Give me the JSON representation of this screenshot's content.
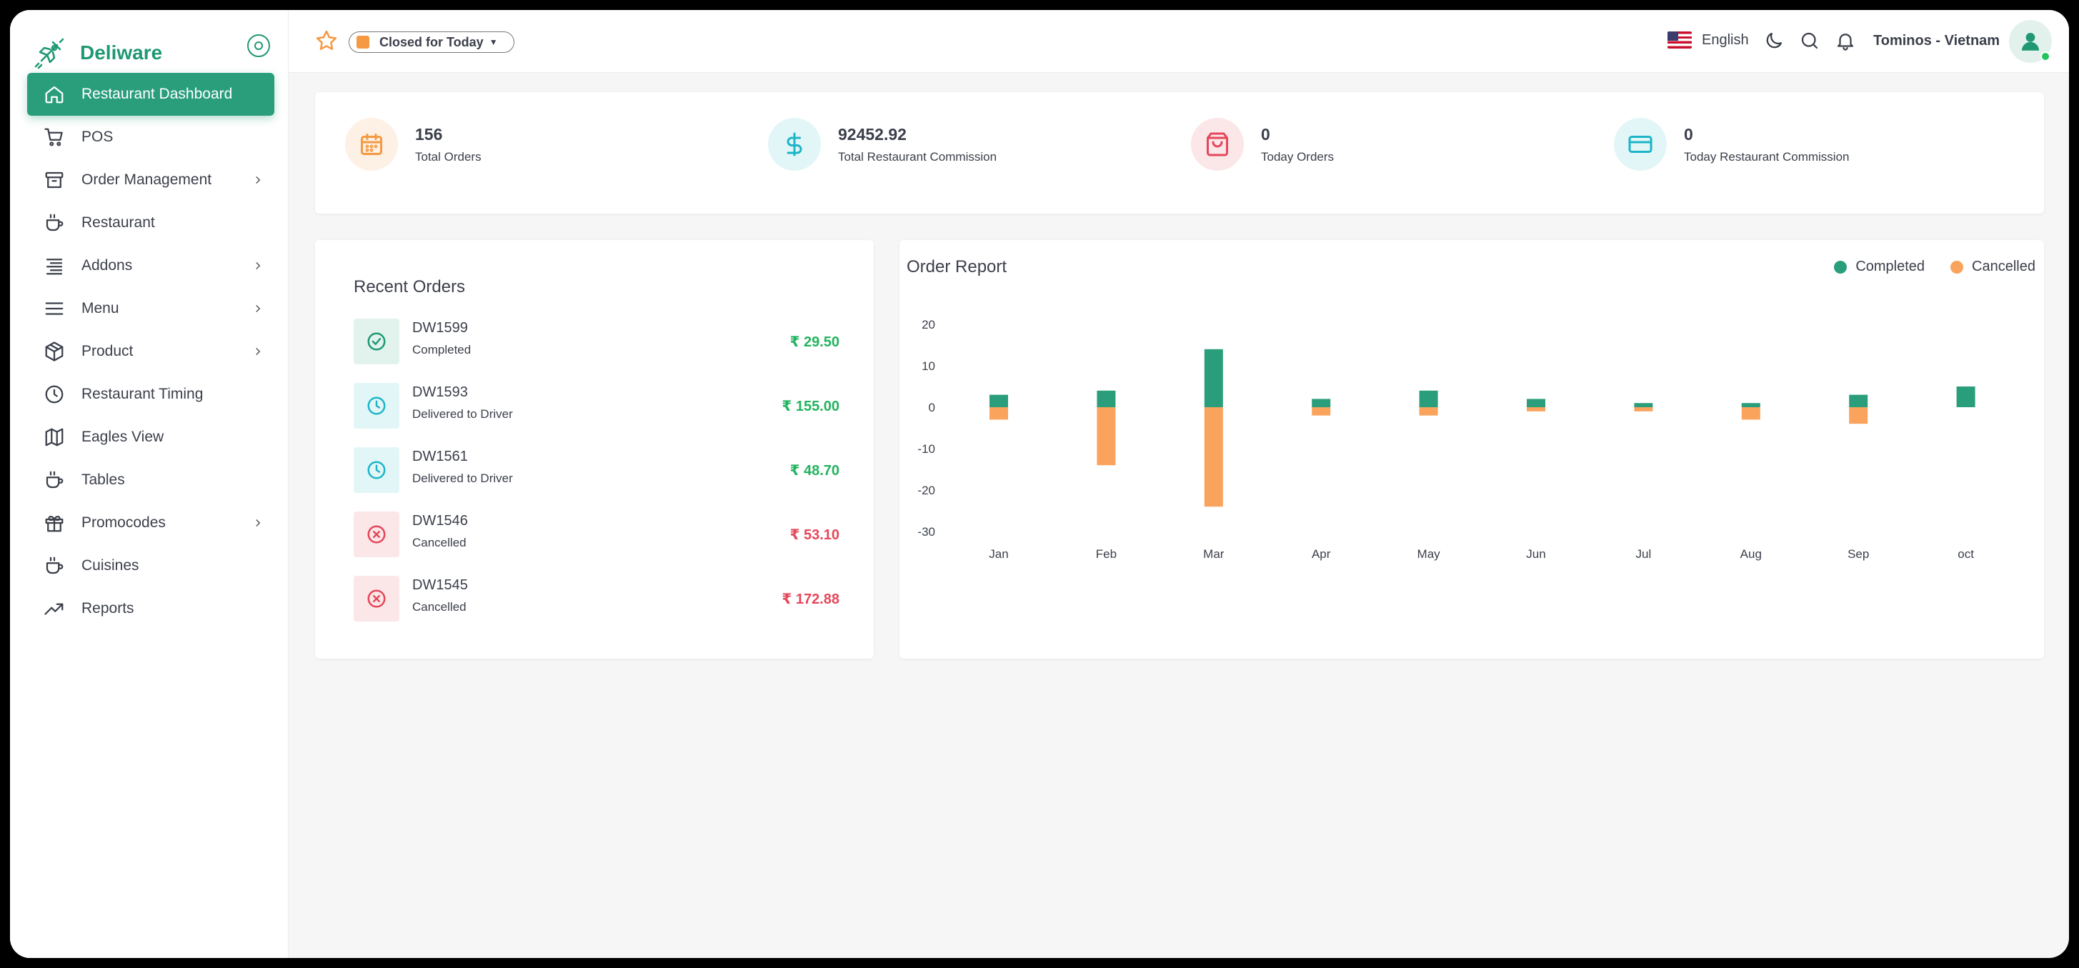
{
  "brand": {
    "name": "Deliware",
    "color": "#1f9873"
  },
  "sidebar": {
    "items": [
      {
        "label": "Restaurant Dashboard",
        "icon": "home-icon",
        "active": true,
        "chevron": false
      },
      {
        "label": "POS",
        "icon": "cart-icon",
        "active": false,
        "chevron": false
      },
      {
        "label": "Order Management",
        "icon": "archive-icon",
        "active": false,
        "chevron": true
      },
      {
        "label": "Restaurant",
        "icon": "cup-icon",
        "active": false,
        "chevron": false
      },
      {
        "label": "Addons",
        "icon": "list-icon",
        "active": false,
        "chevron": true
      },
      {
        "label": "Menu",
        "icon": "menu-icon",
        "active": false,
        "chevron": true
      },
      {
        "label": "Product",
        "icon": "box-icon",
        "active": false,
        "chevron": true
      },
      {
        "label": "Restaurant Timing",
        "icon": "clock-icon",
        "active": false,
        "chevron": false
      },
      {
        "label": "Eagles View",
        "icon": "map-icon",
        "active": false,
        "chevron": false
      },
      {
        "label": "Tables",
        "icon": "cup-icon",
        "active": false,
        "chevron": false
      },
      {
        "label": "Promocodes",
        "icon": "gift-icon",
        "active": false,
        "chevron": true
      },
      {
        "label": "Cuisines",
        "icon": "cup-icon",
        "active": false,
        "chevron": false
      },
      {
        "label": "Reports",
        "icon": "trending-icon",
        "active": false,
        "chevron": false
      }
    ]
  },
  "topbar": {
    "status": "Closed for Today",
    "language": "English",
    "user": "Tominos - Vietnam"
  },
  "stats": [
    {
      "value": "156",
      "label": "Total Orders",
      "icon": "calendar-icon",
      "color": "#f59942",
      "bg": "#fdf0e4"
    },
    {
      "value": "92452.92",
      "label": "Total Restaurant Commission",
      "icon": "dollar-icon",
      "color": "#1cb5c8",
      "bg": "#e2f6f8"
    },
    {
      "value": "0",
      "label": "Today Orders",
      "icon": "shopping-bag-icon",
      "color": "#e4475a",
      "bg": "#fbe6e8"
    },
    {
      "value": "0",
      "label": "Today Restaurant Commission",
      "icon": "credit-card-icon",
      "color": "#1cb5c8",
      "bg": "#e2f6f8"
    }
  ],
  "recent_orders": {
    "title": "Recent Orders",
    "items": [
      {
        "id": "DW1599",
        "status": "Completed",
        "amount": "₹ 29.50",
        "kind": "completed"
      },
      {
        "id": "DW1593",
        "status": "Delivered to Driver",
        "amount": "₹ 155.00",
        "kind": "delivered"
      },
      {
        "id": "DW1561",
        "status": "Delivered to Driver",
        "amount": "₹ 48.70",
        "kind": "delivered"
      },
      {
        "id": "DW1546",
        "status": "Cancelled",
        "amount": "₹ 53.10",
        "kind": "cancelled"
      },
      {
        "id": "DW1545",
        "status": "Cancelled",
        "amount": "₹ 172.88",
        "kind": "cancelled"
      }
    ]
  },
  "report": {
    "title": "Order Report",
    "legend": [
      {
        "name": "Completed",
        "color": "#2a9e7b"
      },
      {
        "name": "Cancelled",
        "color": "#f9a35c"
      }
    ]
  },
  "chart_data": {
    "type": "bar",
    "categories": [
      "Jan",
      "Feb",
      "Mar",
      "Apr",
      "May",
      "Jun",
      "Jul",
      "Aug",
      "Sep",
      "oct"
    ],
    "series": [
      {
        "name": "Completed",
        "values": [
          3,
          4,
          14,
          2,
          4,
          2,
          1,
          1,
          3,
          5
        ]
      },
      {
        "name": "Cancelled",
        "values": [
          -3,
          -14,
          -24,
          -2,
          -2,
          -1,
          -1,
          -3,
          -4,
          0
        ]
      }
    ],
    "ylim": [
      -30,
      20
    ],
    "yticks": [
      20,
      10,
      0,
      -10,
      -20,
      -30
    ],
    "stacked": true
  }
}
